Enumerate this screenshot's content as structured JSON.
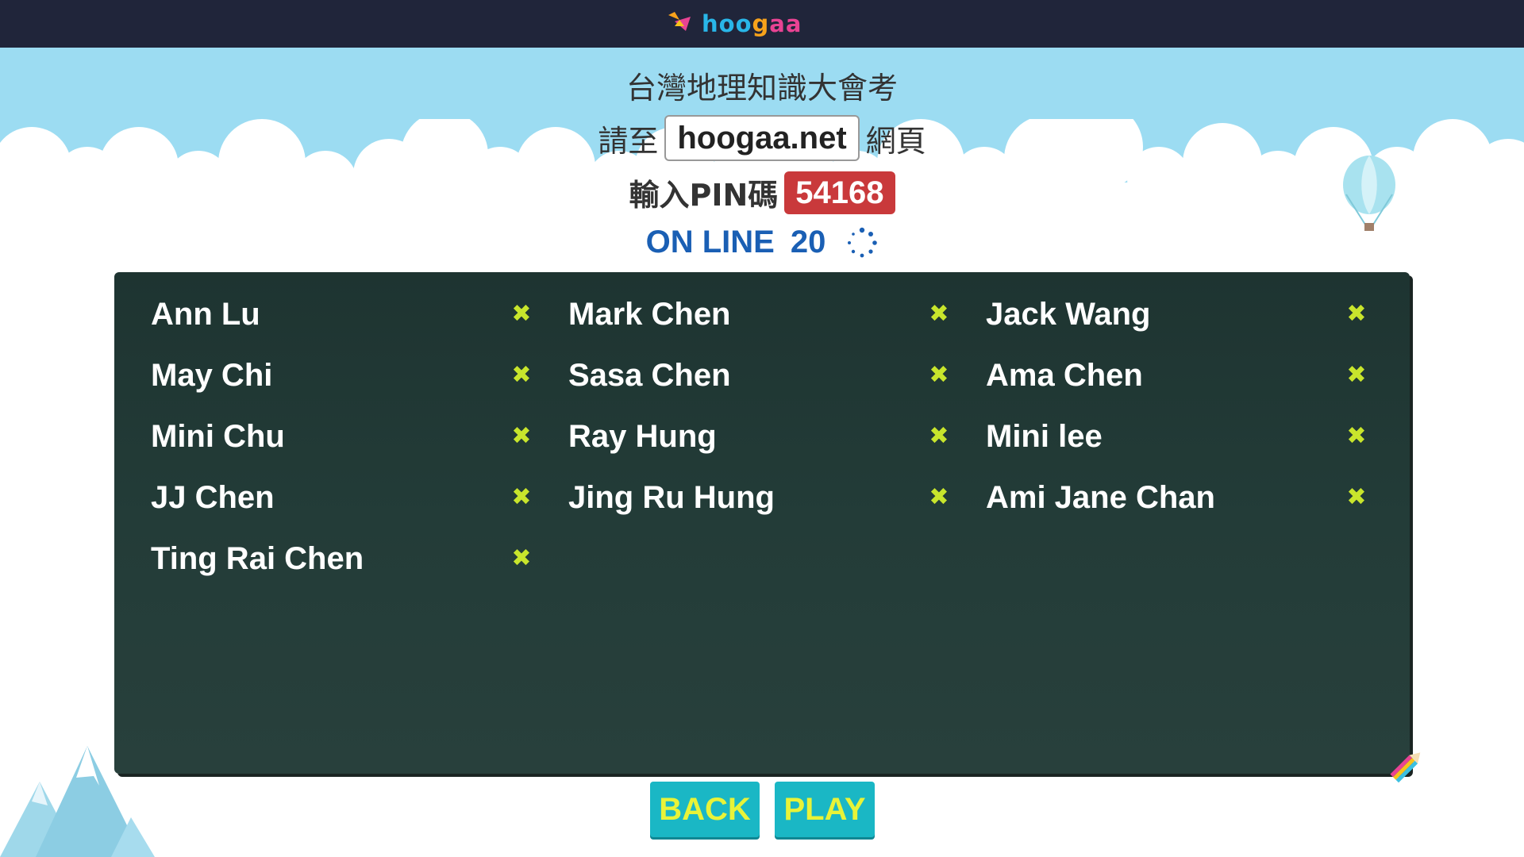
{
  "header": {
    "logo_text": [
      "hoo",
      "g",
      "aa"
    ],
    "logo_icon": "bird-logo-icon"
  },
  "quiz": {
    "title": "台灣地理知識大會考",
    "goto_prefix": "請至",
    "url": "hoogaa.net",
    "goto_suffix": "網頁",
    "pin_label": "輸入PIN碼",
    "pin_code": "54168",
    "online_label": "ON LINE",
    "online_count": "20"
  },
  "players": [
    {
      "name": "Ann Lu"
    },
    {
      "name": "Mark Chen"
    },
    {
      "name": "Jack Wang"
    },
    {
      "name": "May Chi"
    },
    {
      "name": "Sasa Chen"
    },
    {
      "name": "Ama Chen"
    },
    {
      "name": "Mini Chu"
    },
    {
      "name": "Ray Hung"
    },
    {
      "name": "Mini lee"
    },
    {
      "name": "JJ Chen"
    },
    {
      "name": "Jing Ru Hung"
    },
    {
      "name": "Ami Jane Chan"
    },
    {
      "name": "Ting Rai Chen"
    }
  ],
  "kick_icon": "close-x-icon",
  "buttons": {
    "back": "BACK",
    "play": "PLAY"
  },
  "colors": {
    "topbar": "#20253a",
    "sky": "#9cdcf2",
    "board": "#233c38",
    "pin_badge": "#c9393b",
    "online": "#1a5fb4",
    "button_bg": "#1ab7c5",
    "button_text": "#e8f338",
    "kick_icon": "#c8e52c"
  }
}
